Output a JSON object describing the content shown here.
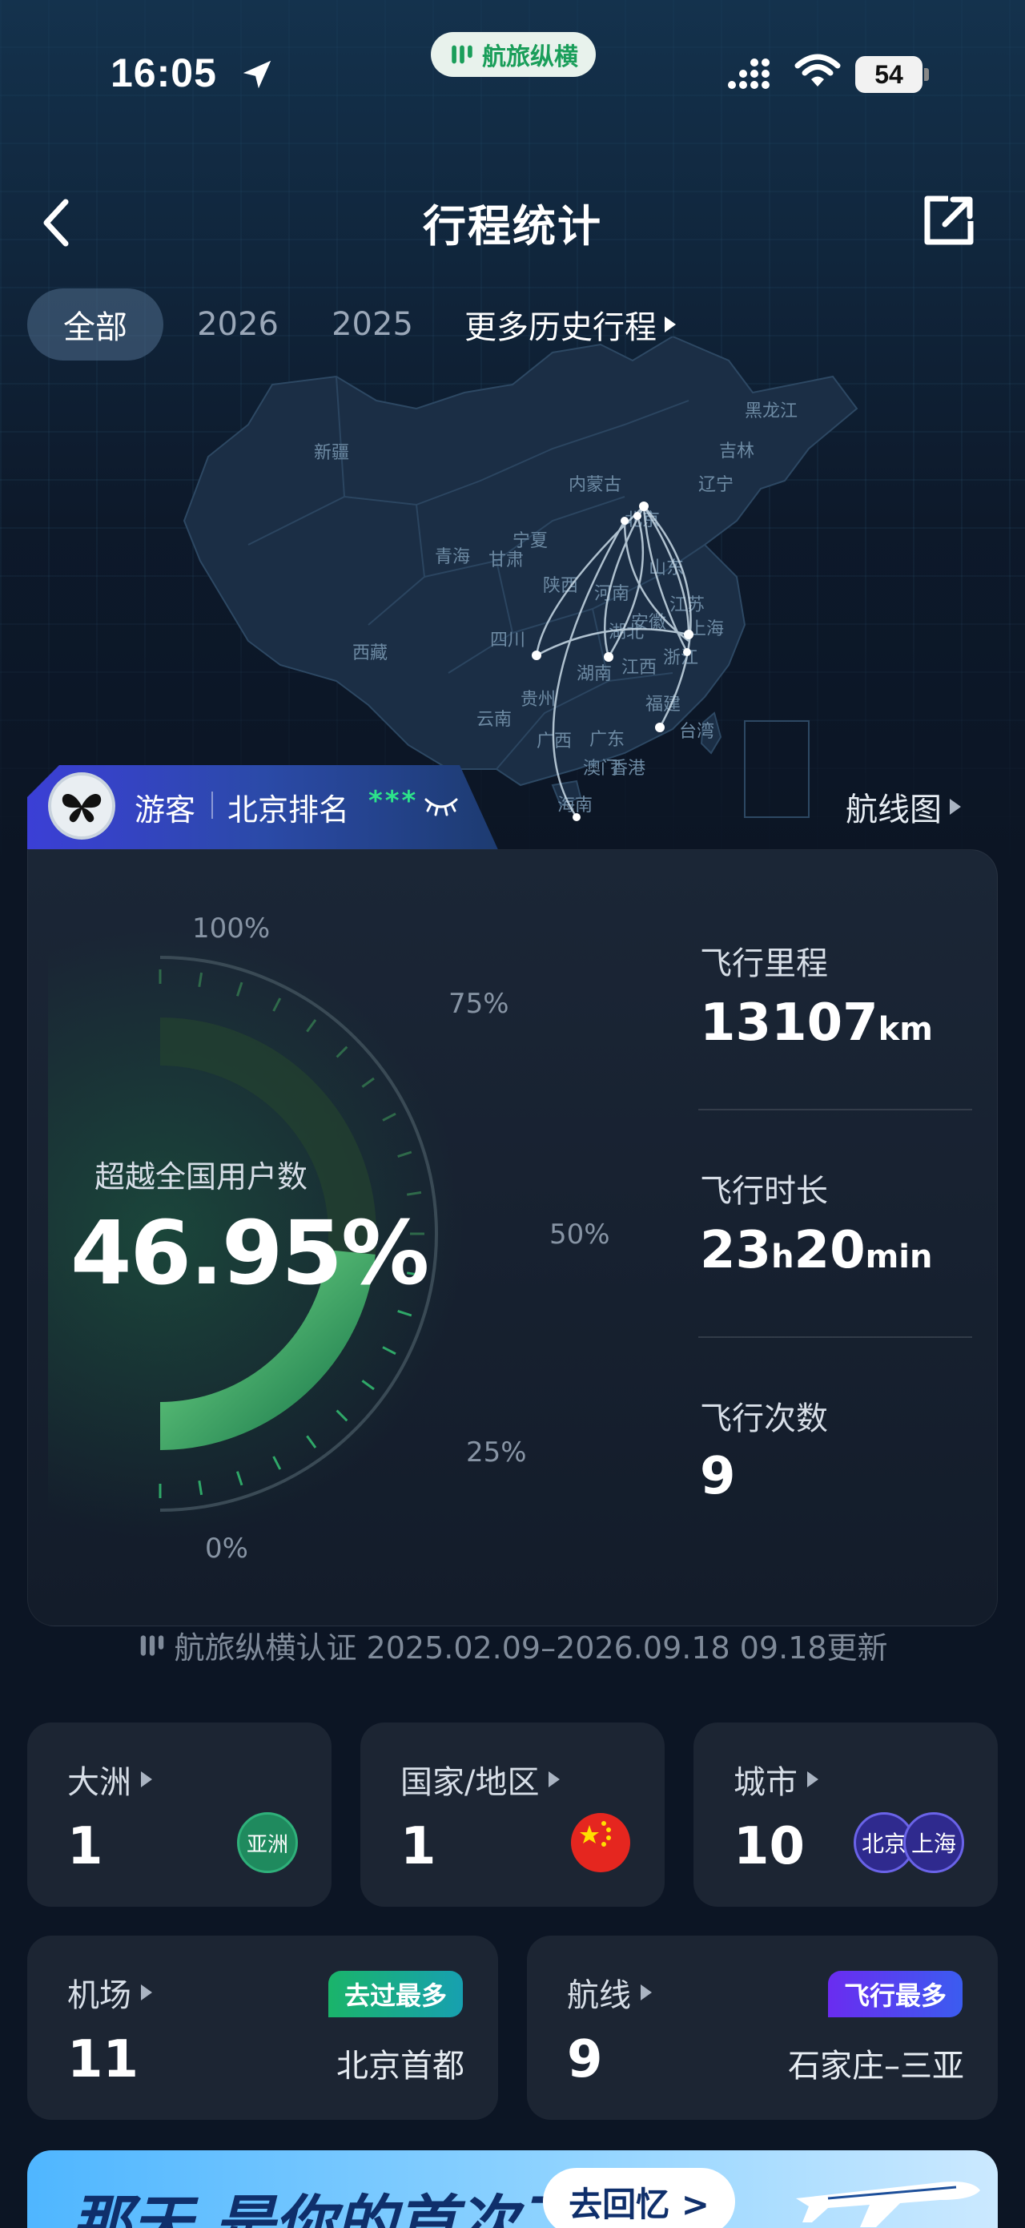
{
  "status_bar": {
    "time": "16:05",
    "battery": "54",
    "brand": "航旅纵横"
  },
  "nav": {
    "title": "行程统计"
  },
  "tabs": [
    "全部",
    "2026",
    "2025"
  ],
  "tabs_more": "更多历史行程",
  "map": {
    "provinces": [
      "新疆",
      "西藏",
      "青海",
      "甘肃",
      "宁夏",
      "内蒙古",
      "四川",
      "陕西",
      "河南",
      "湖北",
      "湖南",
      "贵州",
      "云南",
      "广西",
      "广东",
      "江西",
      "福建",
      "浙江",
      "安徽",
      "江苏",
      "上海",
      "山东",
      "北京",
      "辽宁",
      "吉林",
      "黑龙江",
      "台湾",
      "香港",
      "澳门",
      "海南"
    ]
  },
  "user": {
    "name": "游客",
    "rank_label": "北京排名",
    "rank_value": "***"
  },
  "route_map_link": "航线图",
  "gauge": {
    "label": "超越全国用户数",
    "value": "46.95%",
    "percent": 46.95,
    "ticks": [
      "100%",
      "75%",
      "50%",
      "25%",
      "0%"
    ]
  },
  "metrics": {
    "distance": {
      "label": "飞行里程",
      "value": "13107",
      "unit": "km"
    },
    "duration": {
      "label": "飞行时长",
      "hours": "23",
      "h_unit": "h",
      "minutes": "20",
      "m_unit": "min"
    },
    "flights": {
      "label": "飞行次数",
      "value": "9"
    }
  },
  "certification": "航旅纵横认证 2025.02.09–2026.09.18 09.18更新",
  "tiles": {
    "continent": {
      "label": "大洲",
      "value": "1",
      "badge": "亚洲"
    },
    "country": {
      "label": "国家/地区",
      "value": "1"
    },
    "city": {
      "label": "城市",
      "value": "10",
      "badges": [
        "北京",
        "上海"
      ]
    },
    "airport": {
      "label": "机场",
      "value": "11",
      "tag": "去过最多",
      "top": "北京首都"
    },
    "route": {
      "label": "航线",
      "value": "9",
      "tag": "飞行最多",
      "top": "石家庄–三亚"
    }
  },
  "promo": {
    "title": "那天 是你的首次飞行",
    "button": "去回忆 >"
  },
  "colors": {
    "accent_green": "#2de38a",
    "accent_purple": "#5b3df0",
    "card_bg": "#1c2533"
  }
}
